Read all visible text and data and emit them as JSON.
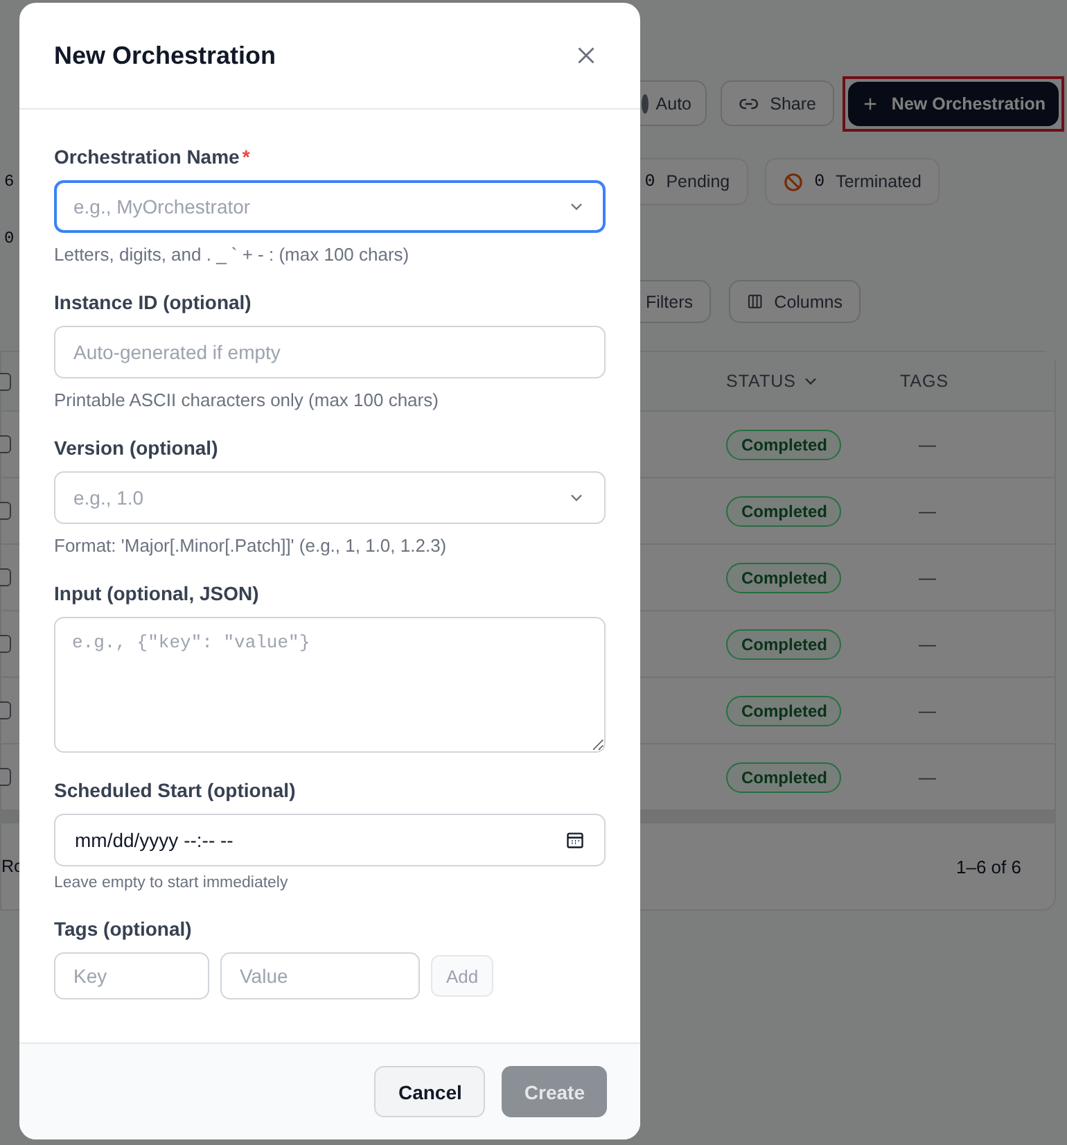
{
  "page": {
    "auto_toggle": {
      "label": "Auto",
      "on": false
    },
    "share_button": "Share",
    "new_button": {
      "label": "New Orchestration",
      "highlighted": true
    },
    "stat_fragments": [
      "6",
      "0"
    ],
    "stats": [
      {
        "count": "0",
        "label": "Pending",
        "kind": "pending"
      },
      {
        "count": "0",
        "label": "Terminated",
        "kind": "terminated"
      }
    ],
    "filters_button": "Filters",
    "columns_button": "Columns",
    "table": {
      "columns": [
        "STATUS",
        "TAGS"
      ],
      "select_all_checked": false,
      "rows": [
        {
          "checked": false,
          "status": "Completed",
          "tags": "—"
        },
        {
          "checked": false,
          "status": "Completed",
          "tags": "—"
        },
        {
          "checked": false,
          "status": "Completed",
          "tags": "—"
        },
        {
          "checked": false,
          "status": "Completed",
          "tags": "—"
        },
        {
          "checked": false,
          "status": "Completed",
          "tags": "—"
        },
        {
          "checked": false,
          "status": "Completed",
          "tags": "—"
        }
      ],
      "footer_fragment": "Ro",
      "range": "1–6 of 6"
    }
  },
  "dialog": {
    "title": "New Orchestration",
    "required_mark": "*",
    "fields": [
      {
        "kind": "combo",
        "label": "Orchestration Name",
        "required": true,
        "focused": true,
        "placeholder": "e.g., MyOrchestrator",
        "help": "Letters, digits, and . _ ` + - : (max 100 chars)"
      },
      {
        "kind": "text",
        "label": "Instance ID (optional)",
        "required": false,
        "focused": false,
        "placeholder": "Auto-generated if empty",
        "help": "Printable ASCII characters only (max 100 chars)"
      },
      {
        "kind": "combo",
        "label": "Version (optional)",
        "required": false,
        "focused": false,
        "placeholder": "e.g., 1.0",
        "help": "Format: 'Major[.Minor[.Patch]]' (e.g., 1, 1.0, 1.2.3)"
      },
      {
        "kind": "textarea",
        "label": "Input (optional, JSON)",
        "required": false,
        "focused": false,
        "placeholder": "e.g., {\"key\": \"value\"}"
      },
      {
        "kind": "datetime",
        "label": "Scheduled Start (optional)",
        "required": false,
        "focused": false,
        "value": "mm/dd/yyyy --:-- --",
        "help": "Leave empty to start immediately"
      }
    ],
    "tags": {
      "label": "Tags (optional)",
      "key_placeholder": "Key",
      "value_placeholder": "Value",
      "add_button": {
        "label": "Add",
        "disabled": true
      }
    },
    "buttons": [
      {
        "label": "Cancel",
        "kind": "secondary",
        "disabled": false
      },
      {
        "label": "Create",
        "kind": "primary",
        "disabled": true
      }
    ]
  }
}
